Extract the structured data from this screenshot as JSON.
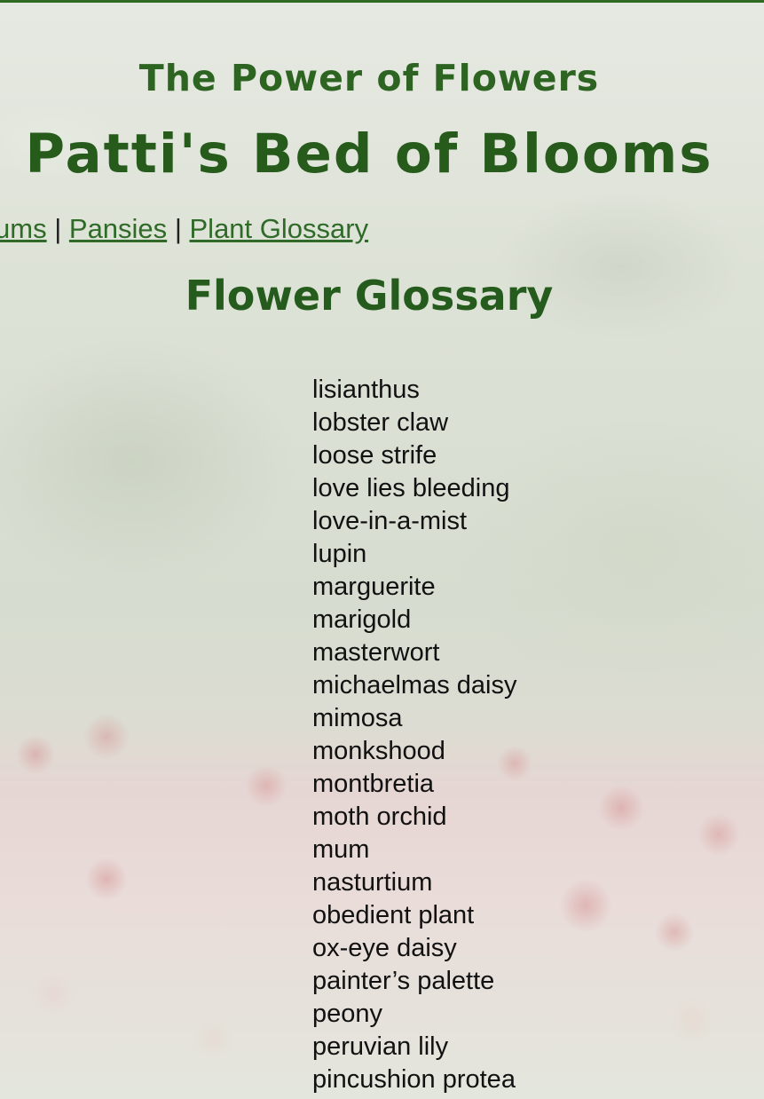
{
  "header": {
    "kicker": "The Power of Flowers",
    "site_title": "Patti's Bed of Blooms"
  },
  "nav": {
    "items": [
      {
        "label": "ums"
      },
      {
        "label": "Pansies"
      },
      {
        "label": "Plant Glossary"
      }
    ],
    "separator": "|"
  },
  "main": {
    "heading": "Flower Glossary",
    "terms": [
      "lisianthus",
      "lobster claw",
      "loose strife",
      "love lies bleeding",
      "love-in-a-mist",
      "lupin",
      "marguerite",
      "marigold",
      "masterwort",
      "michaelmas daisy",
      "mimosa",
      "monkshood",
      "montbretia",
      "moth orchid",
      "mum",
      "nasturtium",
      "obedient plant",
      "ox-eye daisy",
      "painter’s palette",
      "peony",
      "peruvian lily",
      "pincushion protea"
    ]
  },
  "colors": {
    "heading_green": "#265b1c",
    "link_green": "#2f6a28",
    "top_rule": "#2d6a24"
  }
}
